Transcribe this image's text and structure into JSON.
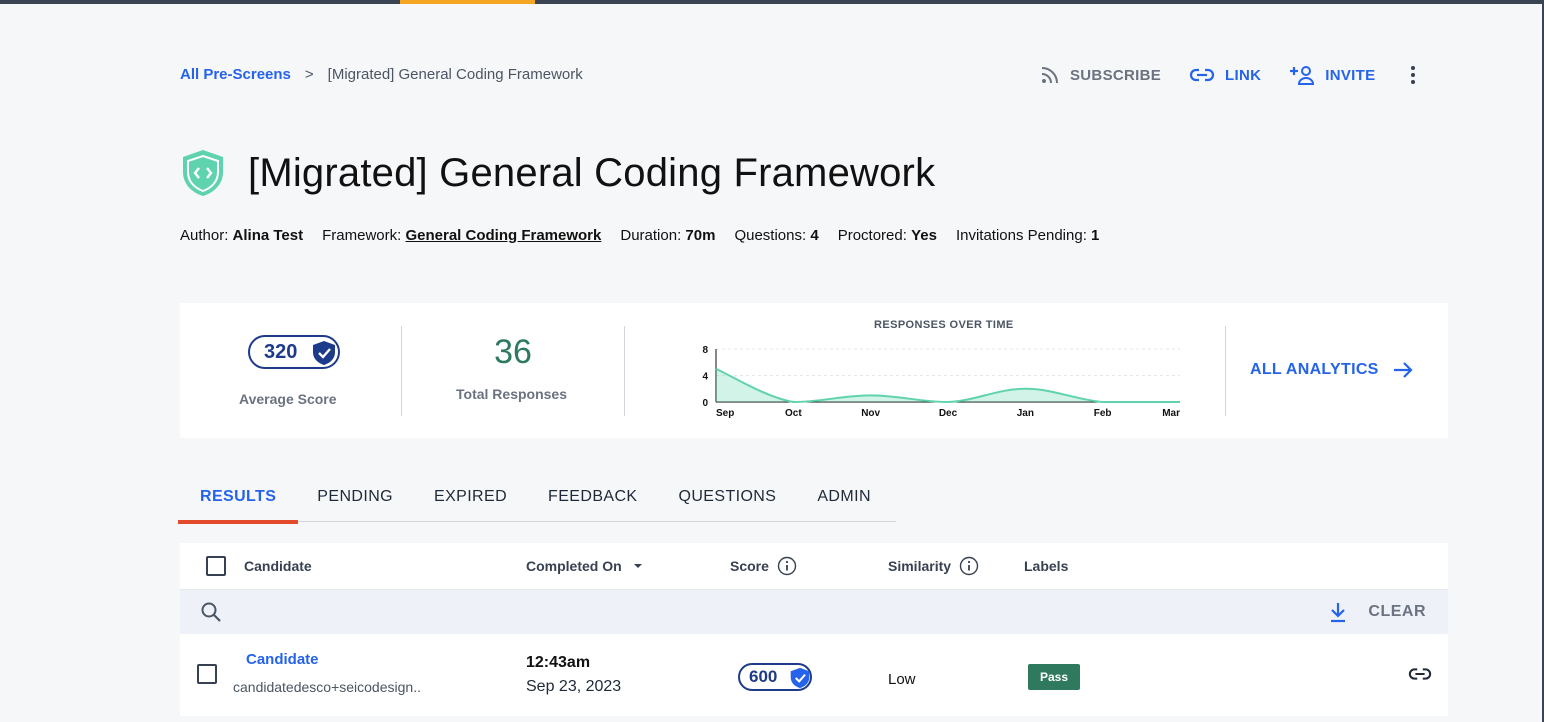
{
  "breadcrumb": {
    "root": "All Pre-Screens",
    "separator": ">",
    "current": "[Migrated] General Coding Framework"
  },
  "actions": {
    "subscribe": "SUBSCRIBE",
    "link": "LINK",
    "invite": "INVITE"
  },
  "title": "[Migrated] General Coding Framework",
  "meta": {
    "author_label": "Author:",
    "author": "Alina Test",
    "framework_label": "Framework:",
    "framework": "General Coding Framework",
    "duration_label": "Duration:",
    "duration": "70m",
    "questions_label": "Questions:",
    "questions": "4",
    "proctored_label": "Proctored:",
    "proctored": "Yes",
    "pending_label": "Invitations Pending:",
    "pending": "1"
  },
  "stats": {
    "average_score": "320",
    "average_score_label": "Average Score",
    "total_responses": "36",
    "total_responses_label": "Total Responses",
    "all_analytics": "ALL ANALYTICS"
  },
  "chart_data": {
    "type": "area",
    "title": "RESPONSES OVER TIME",
    "categories": [
      "Sep",
      "Oct",
      "Nov",
      "Dec",
      "Jan",
      "Feb",
      "Mar"
    ],
    "values": [
      5,
      0,
      1,
      0,
      2,
      0,
      0
    ],
    "yticks": [
      "8",
      "4",
      "0"
    ],
    "ylim": [
      0,
      8
    ],
    "grid": true,
    "color": "#5fd3ad"
  },
  "tabs": [
    {
      "label": "RESULTS",
      "active": true
    },
    {
      "label": "PENDING",
      "active": false
    },
    {
      "label": "EXPIRED",
      "active": false
    },
    {
      "label": "FEEDBACK",
      "active": false
    },
    {
      "label": "QUESTIONS",
      "active": false
    },
    {
      "label": "ADMIN",
      "active": false
    }
  ],
  "table": {
    "headers": {
      "candidate": "Candidate",
      "completed_on": "Completed On",
      "score": "Score",
      "similarity": "Similarity",
      "labels": "Labels"
    },
    "clear": "CLEAR",
    "rows": [
      {
        "name": "Candidate",
        "email": "candidatedesco+seicodesign..",
        "time": "12:43am",
        "date": "Sep 23, 2023",
        "score": "600",
        "similarity": "Low",
        "label": "Pass"
      }
    ]
  },
  "colors": {
    "accent": "#2563eb",
    "navy": "#1e3a8a",
    "green": "#2f7a5f",
    "tab_indicator": "#e24b2c"
  }
}
